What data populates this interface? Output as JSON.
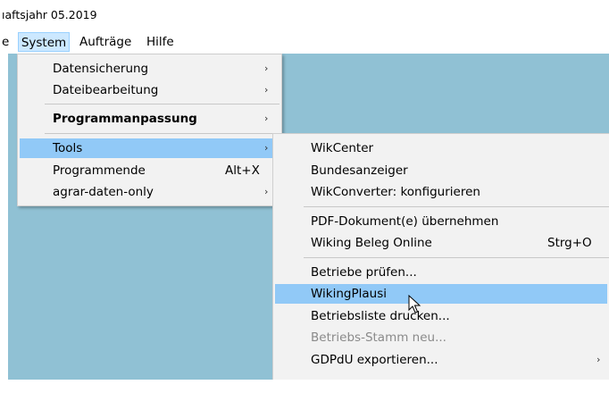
{
  "window": {
    "title_fragment": "ıaftsjahr 05.2019"
  },
  "menubar": {
    "items": [
      {
        "label": "e"
      },
      {
        "label": "System"
      },
      {
        "label": "Aufträge"
      },
      {
        "label": "Hilfe"
      }
    ]
  },
  "system_menu": {
    "items": [
      {
        "label": "Datensicherung",
        "shortcut": "",
        "arrow": "›"
      },
      {
        "label": "Dateibearbeitung",
        "shortcut": "",
        "arrow": "›"
      },
      {
        "label": "Programmanpassung",
        "shortcut": "",
        "arrow": "›"
      },
      {
        "label": "Tools",
        "shortcut": "",
        "arrow": "›"
      },
      {
        "label": "Programmende",
        "shortcut": "Alt+X",
        "arrow": ""
      },
      {
        "label": "agrar-daten-only",
        "shortcut": "",
        "arrow": "›"
      }
    ]
  },
  "tools_menu": {
    "items": [
      {
        "label": "WikCenter",
        "shortcut": "",
        "arrow": ""
      },
      {
        "label": "Bundesanzeiger",
        "shortcut": "",
        "arrow": ""
      },
      {
        "label": "WikConverter: konfigurieren",
        "shortcut": "",
        "arrow": ""
      },
      {
        "label": "PDF-Dokument(e) übernehmen",
        "shortcut": "",
        "arrow": ""
      },
      {
        "label": "Wiking Beleg Online",
        "shortcut": "Strg+O",
        "arrow": ""
      },
      {
        "label": "Betriebe prüfen...",
        "shortcut": "",
        "arrow": ""
      },
      {
        "label": "WikingPlausi",
        "shortcut": "",
        "arrow": ""
      },
      {
        "label": "Betriebsliste drucken...",
        "shortcut": "",
        "arrow": ""
      },
      {
        "label": "Betriebs-Stamm neu...",
        "shortcut": "",
        "arrow": ""
      },
      {
        "label": "GDPdU exportieren...",
        "shortcut": "",
        "arrow": "›"
      }
    ]
  },
  "colors": {
    "desktop": "#90c1d4",
    "menu_bg": "#f2f2f2",
    "highlight": "#91c9f7",
    "menubar_active": "#cce8ff"
  }
}
